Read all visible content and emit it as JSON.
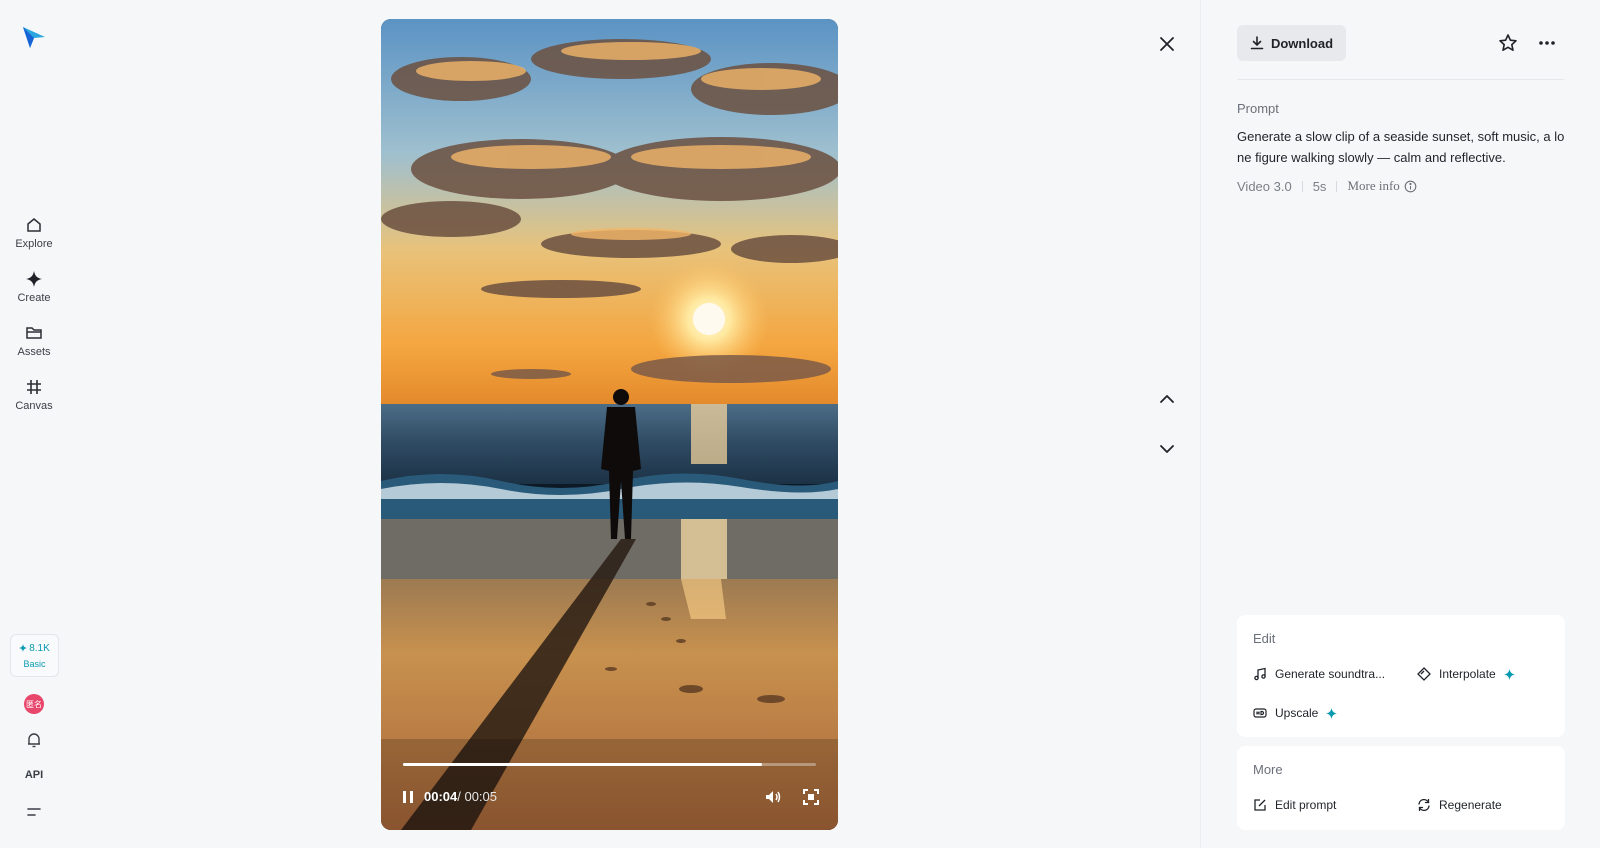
{
  "sidebar": {
    "items": [
      {
        "label": "Explore",
        "icon": "home-icon"
      },
      {
        "label": "Create",
        "icon": "diamond-icon"
      },
      {
        "label": "Assets",
        "icon": "folder-icon"
      },
      {
        "label": "Canvas",
        "icon": "hashtag-icon"
      }
    ],
    "credits": {
      "amount": "8.1K",
      "tier": "Basic"
    },
    "avatar_text": "匿名",
    "api_label": "API"
  },
  "player": {
    "current_time": "00:04",
    "duration": "/ 00:05",
    "progress_fraction": 0.87
  },
  "panel": {
    "download_label": "Download",
    "prompt_label": "Prompt",
    "prompt_text": "Generate a slow clip of a seaside sunset, soft music, a lone figure walking slowly — calm and reflective.",
    "model": "Video 3.0",
    "length": "5s",
    "more_info": "More info",
    "edit": {
      "title": "Edit",
      "actions": [
        "Generate soundtra...",
        "Interpolate",
        "Upscale"
      ]
    },
    "more": {
      "title": "More",
      "actions": [
        "Edit prompt",
        "Regenerate"
      ]
    }
  },
  "colors": {
    "accent": "#0a9ab0",
    "avatar": "#e8466b"
  }
}
